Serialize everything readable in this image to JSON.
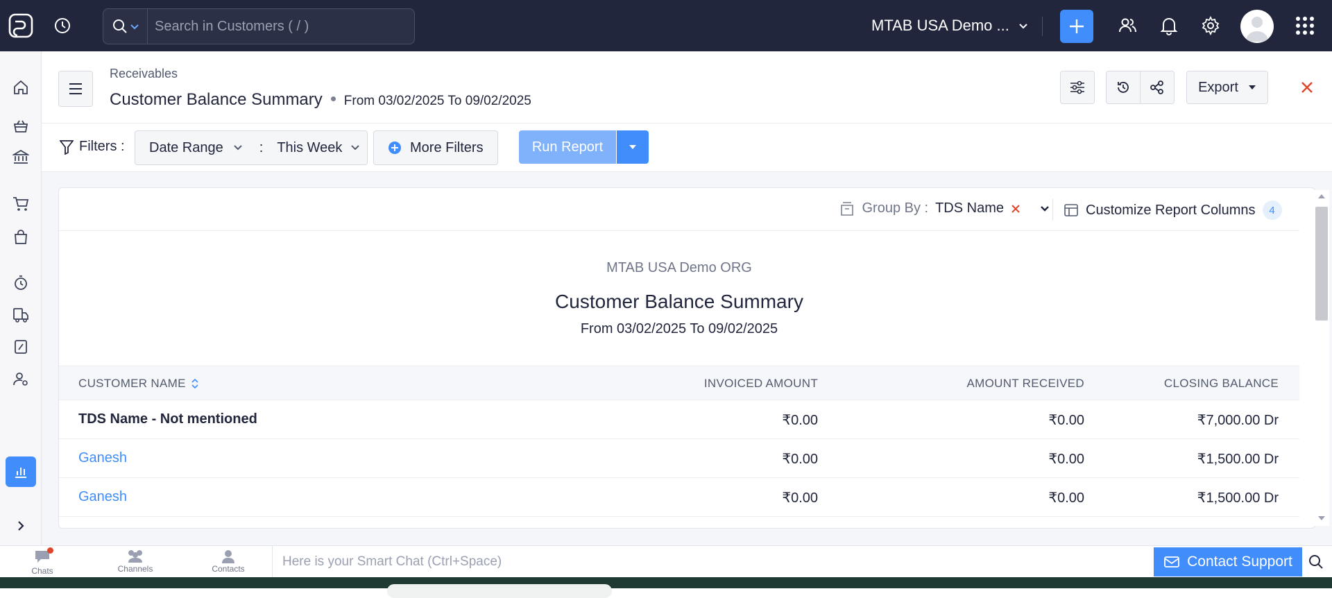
{
  "topbar": {
    "search_placeholder": "Search in Customers ( / )",
    "org_name": "MTAB USA Demo ...",
    "icons": [
      "logo-icon",
      "recent-activity-icon",
      "search-icon",
      "chevron-down-icon",
      "plus-icon",
      "users-icon",
      "bell-icon",
      "gear-icon",
      "avatar",
      "apps-grid-icon"
    ]
  },
  "sidebar": {
    "items": [
      "home-icon",
      "items-icon",
      "banking-icon",
      "sales-icon",
      "purchases-icon",
      "time-tracking-icon",
      "eway-bill-icon",
      "tax-icon",
      "accountant-icon",
      "reports-icon"
    ],
    "active": "reports-icon"
  },
  "header": {
    "breadcrumb": "Receivables",
    "title": "Customer Balance Summary",
    "range": "From 03/02/2025 To 09/02/2025",
    "export_label": "Export"
  },
  "filters": {
    "label": "Filters :",
    "date_range_label": "Date Range",
    "separator": ":",
    "date_range_value": "This Week",
    "more_filters": "More Filters",
    "run_report": "Run Report"
  },
  "report": {
    "group_by_label": "Group By :",
    "group_by_value": "TDS Name",
    "customize_label": "Customize Report Columns",
    "customize_count": "4",
    "org": "MTAB USA Demo ORG",
    "title": "Customer Balance Summary",
    "range": "From 03/02/2025 To 09/02/2025",
    "columns": {
      "customer_name": "CUSTOMER NAME",
      "invoiced_amount": "INVOICED AMOUNT",
      "amount_received": "AMOUNT RECEIVED",
      "closing_balance": "CLOSING BALANCE"
    },
    "rows": [
      {
        "name": "TDS Name - Not mentioned",
        "invoiced": "₹0.00",
        "received": "₹0.00",
        "closing": "₹7,000.00 Dr"
      },
      {
        "name": "Ganesh",
        "invoiced": "₹0.00",
        "received": "₹0.00",
        "closing": "₹1,500.00 Dr"
      },
      {
        "name": "Ganesh",
        "invoiced": "₹0.00",
        "received": "₹0.00",
        "closing": "₹1,500.00 Dr"
      }
    ]
  },
  "bottombar": {
    "chats": "Chats",
    "channels": "Channels",
    "contacts": "Contacts",
    "smart_chat_placeholder": "Here is your Smart Chat (Ctrl+Space)",
    "contact_support": "Contact Support"
  },
  "colors": {
    "topbar_bg": "#21263c",
    "accent": "#408dfb",
    "danger": "#e0442a"
  }
}
